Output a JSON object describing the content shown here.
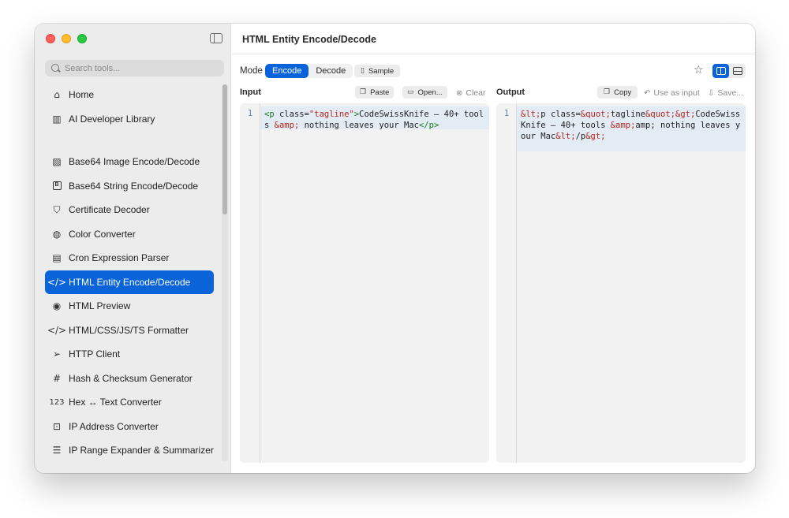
{
  "window": {
    "title": "HTML Entity Encode/Decode"
  },
  "sidebar": {
    "search_placeholder": "Search tools...",
    "items": [
      {
        "label": "Home",
        "icon": "house-icon"
      },
      {
        "label": "AI Developer Library",
        "icon": "books-icon"
      },
      {
        "label": "Base64 Image Encode/Decode",
        "icon": "photo-icon"
      },
      {
        "label": "Base64 String Encode/Decode",
        "icon": "b-square-icon"
      },
      {
        "label": "Certificate Decoder",
        "icon": "shield-check-icon"
      },
      {
        "label": "Color Converter",
        "icon": "palette-icon"
      },
      {
        "label": "Cron Expression Parser",
        "icon": "calendar-clock-icon"
      },
      {
        "label": "HTML Entity Encode/Decode",
        "icon": "code-brackets-icon",
        "active": true
      },
      {
        "label": "HTML Preview",
        "icon": "eye-icon"
      },
      {
        "label": "HTML/CSS/JS/TS Formatter",
        "icon": "code-brackets-icon"
      },
      {
        "label": "HTTP Client",
        "icon": "paperplane-icon"
      },
      {
        "label": "Hash & Checksum Generator",
        "icon": "number-sign-icon"
      },
      {
        "label": "Hex ↔ Text Converter",
        "icon": "123-icon"
      },
      {
        "label": "IP Address Converter",
        "icon": "network-icon"
      },
      {
        "label": "IP Range Expander & Summarizer",
        "icon": "list-icon"
      }
    ]
  },
  "toolbar": {
    "mode_label": "Mode",
    "encode_label": "Encode",
    "decode_label": "Decode",
    "selected_mode": "Encode",
    "sample_label": "Sample",
    "layout_selected": "side-by-side"
  },
  "input_pane": {
    "label": "Input",
    "paste_label": "Paste",
    "open_label": "Open...",
    "clear_label": "Clear",
    "line_number": "1",
    "text": "<p class=\"tagline\">CodeSwissKnife — 40+ tools &amp; nothing leaves your Mac</p>"
  },
  "output_pane": {
    "label": "Output",
    "copy_label": "Copy",
    "use_as_input_label": "Use as input",
    "save_label": "Save...",
    "line_number": "1",
    "text": "&lt;p class=&quot;tagline&quot;&gt;CodeSwissKnife — 40+ tools &amp;amp; nothing leaves your Mac&lt;/p&gt;"
  },
  "colors": {
    "accent": "#0a63d8",
    "sidebar_bg": "#ececec",
    "editor_bg": "#f2f2f2"
  }
}
